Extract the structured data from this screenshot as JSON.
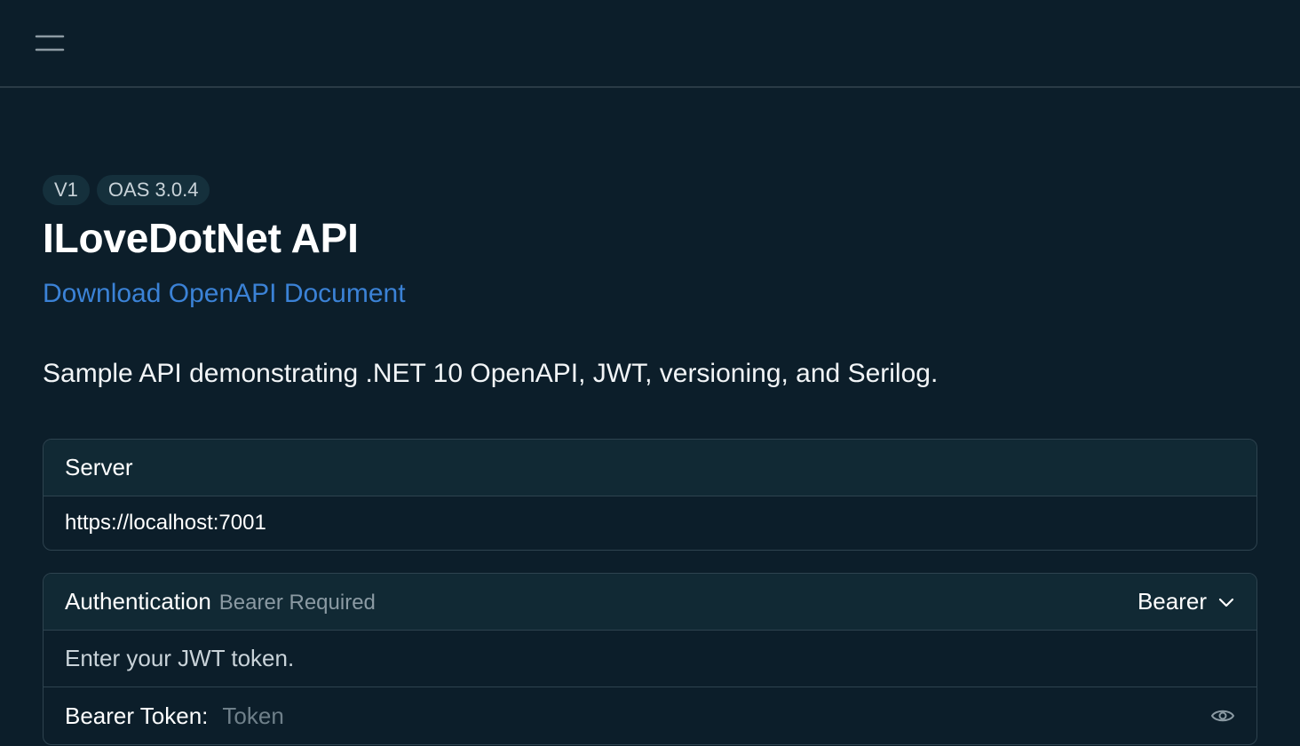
{
  "topbar": {
    "menu_icon": "hamburger-menu-icon"
  },
  "header": {
    "badges": [
      "V1",
      "OAS 3.0.4"
    ],
    "title": "ILoveDotNet API",
    "download_link": "Download OpenAPI Document",
    "description": "Sample API demonstrating .NET 10 OpenAPI, JWT, versioning, and Serilog."
  },
  "server": {
    "label": "Server",
    "url": "https://localhost:7001"
  },
  "auth": {
    "label": "Authentication",
    "sublabel": "Bearer Required",
    "scheme_selected": "Bearer",
    "description": "Enter your JWT token.",
    "token_label": "Bearer Token:",
    "token_placeholder": "Token",
    "token_value": "",
    "eye_icon": "eye-icon",
    "chevron_icon": "chevron-down-icon"
  },
  "colors": {
    "background": "#0c1e2a",
    "panel_header": "#112934",
    "border": "#2e434f",
    "link": "#3b82d6",
    "badge_bg": "#15303c",
    "muted_text": "#8b9aa3"
  }
}
